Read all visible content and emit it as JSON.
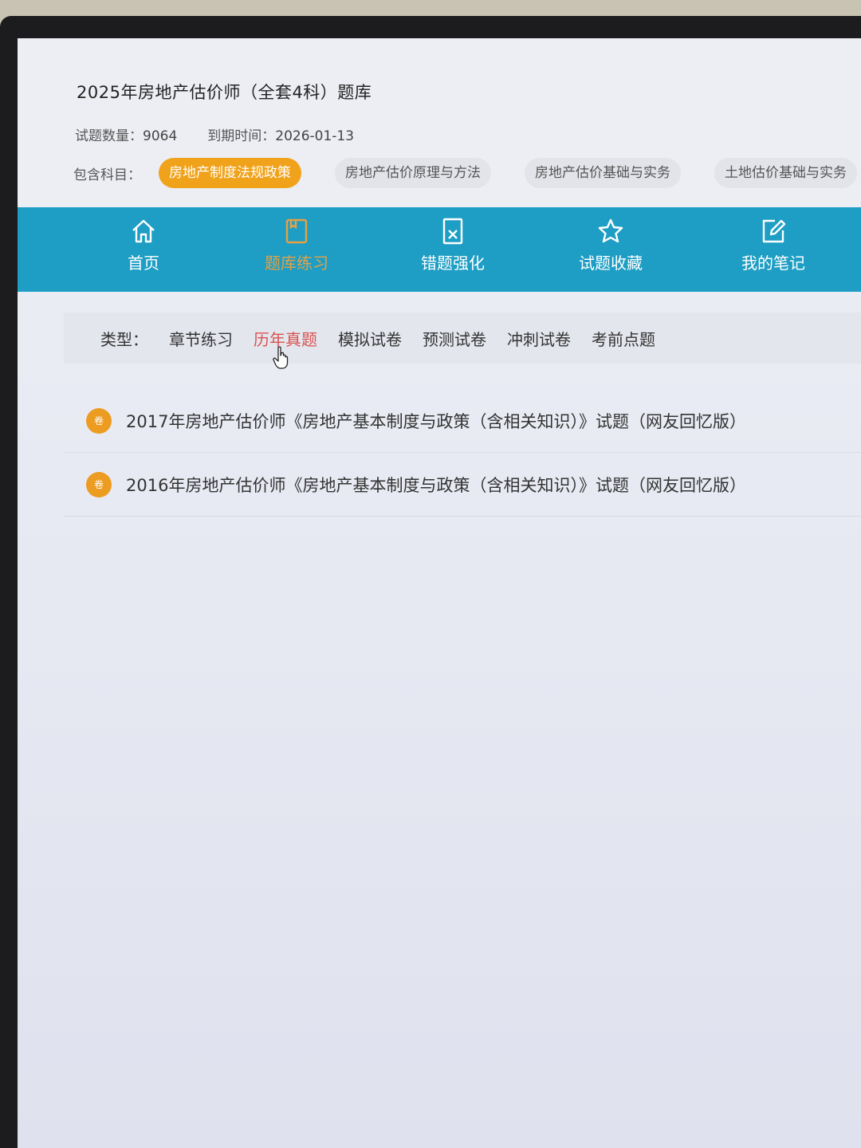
{
  "header": {
    "title": "2025年房地产估价师（全套4科）题库",
    "count_label": "试题数量：",
    "count_value": "9064",
    "expiry_label": "到期时间：",
    "expiry_value": "2026-01-13",
    "subjects_label": "包含科目：",
    "subjects": [
      "房地产制度法规政策",
      "房地产估价原理与方法",
      "房地产估价基础与实务",
      "土地估价基础与实务"
    ]
  },
  "nav": {
    "items": [
      {
        "label": "首页",
        "icon": "home-icon"
      },
      {
        "label": "题库练习",
        "icon": "book-icon"
      },
      {
        "label": "错题强化",
        "icon": "wrong-doc-icon"
      },
      {
        "label": "试题收藏",
        "icon": "star-icon"
      },
      {
        "label": "我的笔记",
        "icon": "edit-icon"
      }
    ],
    "active_index": 1
  },
  "filter": {
    "label": "类型：",
    "tabs": [
      "章节练习",
      "历年真题",
      "模拟试卷",
      "预测试卷",
      "冲刺试卷",
      "考前点题"
    ],
    "active_index": 1
  },
  "list": {
    "badge": "卷",
    "items": [
      "2017年房地产估价师《房地产基本制度与政策（含相关知识）》试题（网友回忆版）",
      "2016年房地产估价师《房地产基本制度与政策（含相关知识）》试题（网友回忆版）"
    ]
  },
  "colors": {
    "nav_bg": "#1e9ec4",
    "accent_orange": "#f0a21a",
    "active_tab": "#d9534f"
  }
}
